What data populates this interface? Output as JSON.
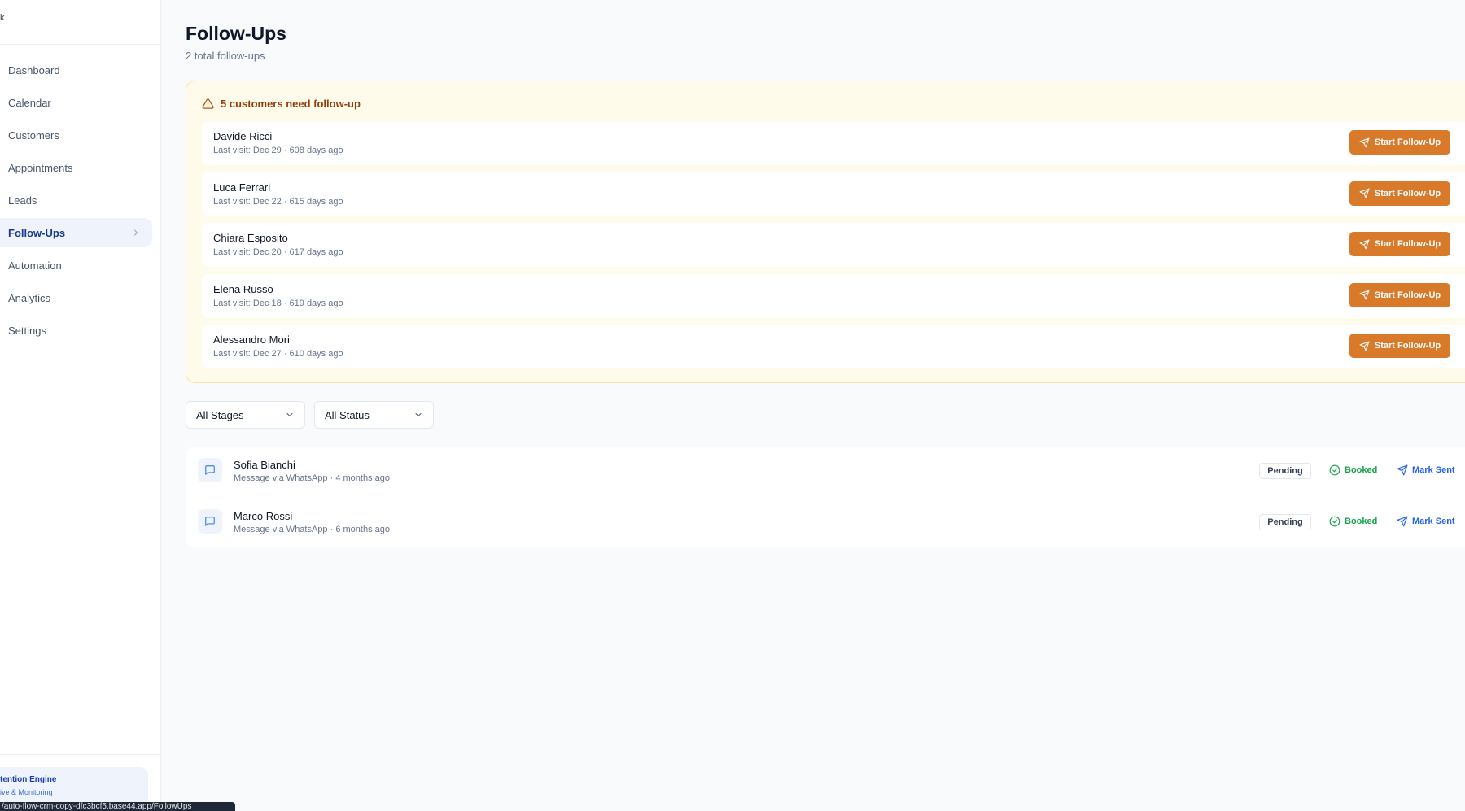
{
  "sidebar": {
    "logo_text": "k",
    "items": [
      {
        "label": "Dashboard"
      },
      {
        "label": "Calendar"
      },
      {
        "label": "Customers"
      },
      {
        "label": "Appointments"
      },
      {
        "label": "Leads"
      },
      {
        "label": "Follow-Ups",
        "active": true
      },
      {
        "label": "Automation"
      },
      {
        "label": "Analytics"
      },
      {
        "label": "Settings"
      }
    ],
    "engine_card": {
      "title": "tention Engine",
      "subtitle": "ive & Monitoring"
    },
    "url_tooltip": "/auto-flow-crm-copy-dfc3bcf5.base44.app/FollowUps"
  },
  "header": {
    "title": "Follow-Ups",
    "subtitle": "2 total follow-ups"
  },
  "alert": {
    "title": "5 customers need follow-up",
    "button_label": "Start Follow-Up",
    "customers": [
      {
        "name": "Davide Ricci",
        "meta": "Last visit: Dec 29 · 608 days ago"
      },
      {
        "name": "Luca Ferrari",
        "meta": "Last visit: Dec 22 · 615 days ago"
      },
      {
        "name": "Chiara Esposito",
        "meta": "Last visit: Dec 20 · 617 days ago"
      },
      {
        "name": "Elena Russo",
        "meta": "Last visit: Dec 18 · 619 days ago"
      },
      {
        "name": "Alessandro Mori",
        "meta": "Last visit: Dec 27 · 610 days ago"
      }
    ]
  },
  "filters": {
    "stage": "All Stages",
    "status": "All Status"
  },
  "followups": [
    {
      "name": "Sofia Bianchi",
      "meta": "Message via WhatsApp · 4 months ago",
      "status": "Pending",
      "booked_label": "Booked",
      "mark_label": "Mark Sent"
    },
    {
      "name": "Marco Rossi",
      "meta": "Message via WhatsApp · 6 months ago",
      "status": "Pending",
      "booked_label": "Booked",
      "mark_label": "Mark Sent"
    }
  ],
  "colors": {
    "accent_orange": "#d97a2b",
    "active_nav": "#1e3a8a",
    "booked_green": "#16a34a",
    "link_blue": "#2563eb"
  }
}
